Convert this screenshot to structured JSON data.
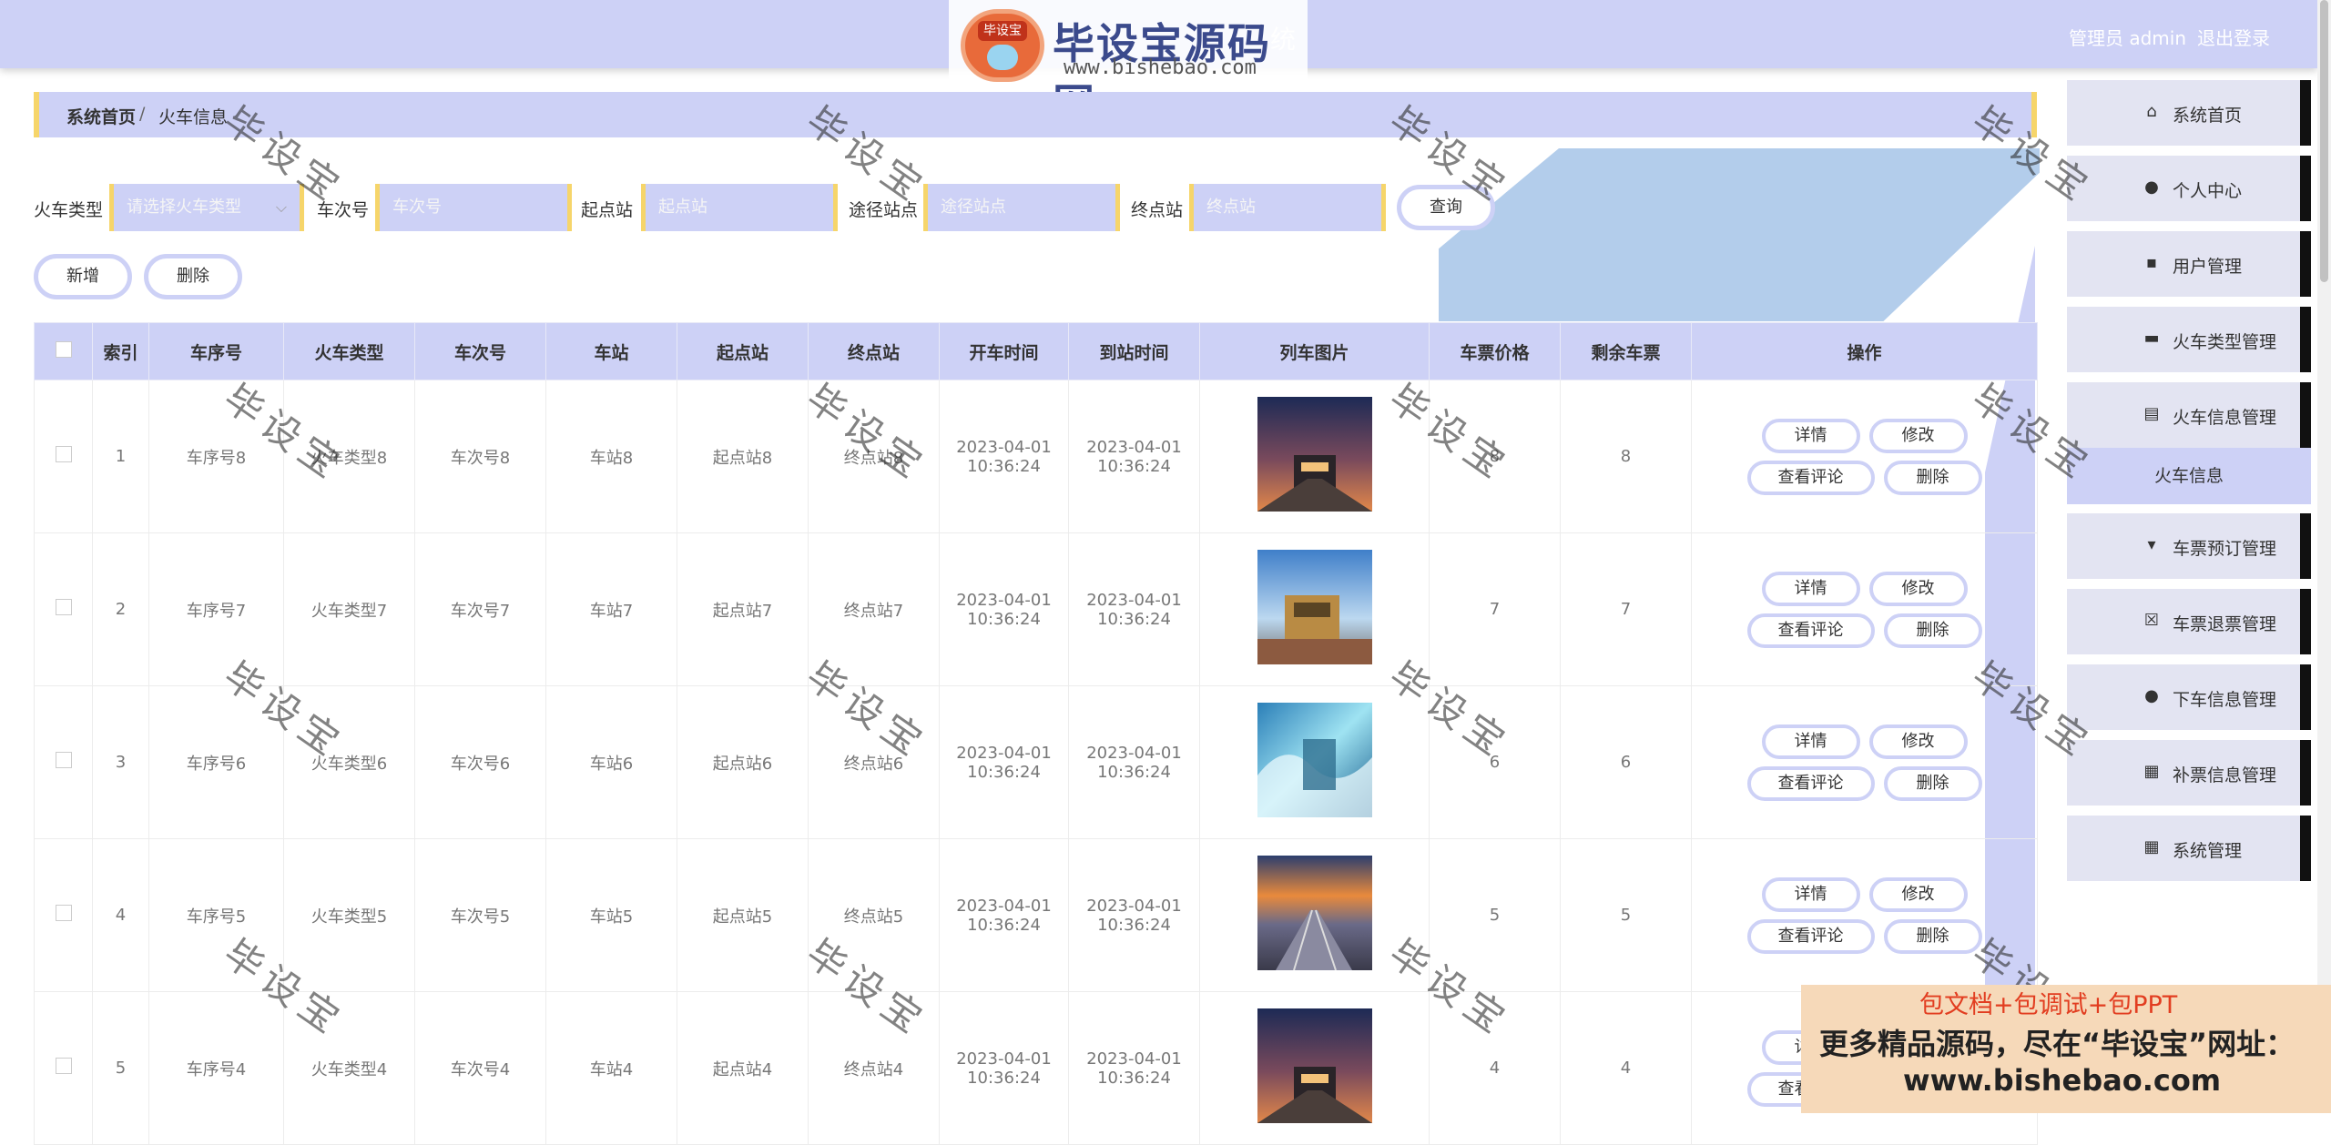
{
  "header": {
    "title_fragment": "统",
    "user_label": "管理员 admin",
    "logout_label": "退出登录",
    "logo_badge": "毕设宝",
    "logo_text": "毕设宝源码网",
    "logo_url": "www.bishebao.com"
  },
  "breadcrumb": {
    "home": "系统首页",
    "separator": "/",
    "current": "火车信息"
  },
  "search": {
    "train_type_label": "火车类型",
    "train_type_placeholder": "请选择火车类型",
    "train_no_label": "车次号",
    "train_no_placeholder": "车次号",
    "start_label": "起点站",
    "start_placeholder": "起点站",
    "via_label": "途径站点",
    "via_placeholder": "途径站点",
    "end_label": "终点站",
    "end_placeholder": "终点站",
    "query_label": "查询"
  },
  "actions": {
    "add_label": "新增",
    "delete_label": "删除"
  },
  "table": {
    "headers": [
      "",
      "索引",
      "车序号",
      "火车类型",
      "车次号",
      "车站",
      "起点站",
      "终点站",
      "开车时间",
      "到站时间",
      "列车图片",
      "车票价格",
      "剩余车票",
      "操作"
    ],
    "op_labels": {
      "detail": "详情",
      "edit": "修改",
      "comments": "查看评论",
      "delete": "删除"
    },
    "rows": [
      {
        "index": "1",
        "seq": "车序号8",
        "type": "火车类型8",
        "train_no": "车次号8",
        "station": "车站8",
        "start": "起点站8",
        "end": "终点站8",
        "depart": "2023-04-01 10:36:24",
        "arrive": "2023-04-01 10:36:24",
        "price": "8",
        "remaining": "8",
        "image_icon": "train-night-photo"
      },
      {
        "index": "2",
        "seq": "车序号7",
        "type": "火车类型7",
        "train_no": "车次号7",
        "station": "车站7",
        "start": "起点站7",
        "end": "终点站7",
        "depart": "2023-04-01 10:36:24",
        "arrive": "2023-04-01 10:36:24",
        "price": "7",
        "remaining": "7",
        "image_icon": "train-daylight-photo"
      },
      {
        "index": "3",
        "seq": "车序号6",
        "type": "火车类型6",
        "train_no": "车次号6",
        "station": "车站6",
        "start": "起点站6",
        "end": "终点站6",
        "depart": "2023-04-01 10:36:24",
        "arrive": "2023-04-01 10:36:24",
        "price": "6",
        "remaining": "6",
        "image_icon": "train-wave-photo"
      },
      {
        "index": "4",
        "seq": "车序号5",
        "type": "火车类型5",
        "train_no": "车次号5",
        "station": "车站5",
        "start": "起点站5",
        "end": "终点站5",
        "depart": "2023-04-01 10:36:24",
        "arrive": "2023-04-01 10:36:24",
        "price": "5",
        "remaining": "5",
        "image_icon": "train-yard-sunset-photo"
      },
      {
        "index": "5",
        "seq": "车序号4",
        "type": "火车类型4",
        "train_no": "车次号4",
        "station": "车站4",
        "start": "起点站4",
        "end": "终点站4",
        "depart": "2023-04-01 10:36:24",
        "arrive": "2023-04-01 10:36:24",
        "price": "4",
        "remaining": "4",
        "image_icon": "train-night-photo"
      }
    ]
  },
  "sidebar": {
    "items": [
      {
        "label": "系统首页",
        "icon": "home-icon"
      },
      {
        "label": "个人中心",
        "icon": "user-icon"
      },
      {
        "label": "用户管理",
        "icon": "chat-icon"
      },
      {
        "label": "火车类型管理",
        "icon": "briefcase-icon"
      },
      {
        "label": "火车信息管理",
        "icon": "clipboard-icon"
      },
      {
        "label": "车票预订管理",
        "icon": "pin-icon"
      },
      {
        "label": "车票退票管理",
        "icon": "cancel-clipboard-icon"
      },
      {
        "label": "下车信息管理",
        "icon": "user-icon"
      },
      {
        "label": "补票信息管理",
        "icon": "grid-icon"
      },
      {
        "label": "系统管理",
        "icon": "grid-icon"
      }
    ],
    "active_sub": "火车信息"
  },
  "watermark": "毕设宝",
  "ad": {
    "line1": "包文档+包调试+包PPT",
    "line2": "更多精品源码，尽在“毕设宝”网址：",
    "line3": "www.bishebao.com"
  }
}
